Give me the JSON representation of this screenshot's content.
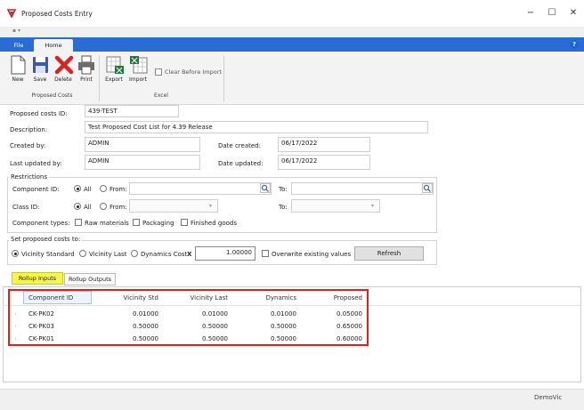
{
  "window": {
    "title": "Proposed Costs Entry",
    "minimize": "−",
    "maximize": "☐",
    "close": "✕",
    "qat": "▪ ▾"
  },
  "ribbon": {
    "tabs": [
      "File",
      "Home"
    ],
    "help": "?",
    "buttons": {
      "new": "New",
      "save": "Save",
      "delete": "Delete",
      "print": "Print",
      "export": "Export",
      "import": "Import"
    },
    "clear_before_import": "Clear Before Import",
    "groups": {
      "proposed_costs": "Proposed Costs",
      "excel": "Excel"
    }
  },
  "form": {
    "proposed_costs_id_label": "Proposed costs ID:",
    "proposed_costs_id": "439-TEST",
    "description_label": "Description:",
    "description": "Test Proposed Cost List for 4.39 Release",
    "created_by_label": "Created by:",
    "created_by": "ADMIN",
    "date_created_label": "Date created:",
    "date_created": "06/17/2022",
    "last_updated_by_label": "Last updated by:",
    "last_updated_by": "ADMIN",
    "date_updated_label": "Date updated:",
    "date_updated": "06/17/2022"
  },
  "restrictions": {
    "title": "Restrictions",
    "component_id_label": "Component ID:",
    "class_id_label": "Class ID:",
    "all": "All",
    "from": "From:",
    "to": "To:",
    "component_types_label": "Component types:",
    "raw_materials": "Raw materials",
    "packaging": "Packaging",
    "finished_goods": "Finished goods"
  },
  "set_costs": {
    "title": "Set proposed costs to:",
    "vicinity_standard": "Vicinity Standard",
    "vicinity_last": "Vicinity Last",
    "dynamics_cost": "Dynamics Cost",
    "multiply": "X",
    "multiplier": "1.00000",
    "overwrite": "Overwrite existing values",
    "refresh": "Refresh"
  },
  "tabs": {
    "rollup_inputs": "Rollup Inputs",
    "rollup_outputs": "Rollup Outputs"
  },
  "grid": {
    "columns": [
      "Component ID",
      "Vicinity Std",
      "Vicinity Last",
      "Dynamics",
      "Proposed"
    ],
    "rows": [
      [
        "CK-PK02",
        "0.01000",
        "0.01000",
        "0.01000",
        "0.05000"
      ],
      [
        "CK-PK03",
        "0.50000",
        "0.50000",
        "0.50000",
        "0.65000"
      ],
      [
        "CK-PK01",
        "0.50000",
        "0.50000",
        "0.50000",
        "0.60000"
      ]
    ]
  },
  "status": "DemoVic"
}
